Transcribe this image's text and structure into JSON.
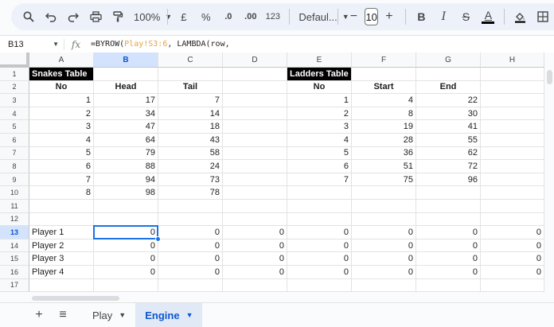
{
  "toolbar": {
    "zoom": "100%",
    "currency": "£",
    "percent": "%",
    "dec_decrease": ".0",
    "dec_increase": ".00",
    "number_format": "123",
    "font": "Defaul...",
    "font_size": "10",
    "minus": "−",
    "plus": "+",
    "bold": "B",
    "italic": "I",
    "strike": "S",
    "text_color": "A"
  },
  "formula_bar": {
    "name_box": "B13",
    "fx": "fx",
    "formula_prefix": "=BYROW(",
    "formula_ref": "Play!S3:6",
    "formula_suffix": ", LAMBDA(row,"
  },
  "columns": [
    "A",
    "B",
    "C",
    "D",
    "E",
    "F",
    "G",
    "H"
  ],
  "selected_column": "B",
  "rows": [
    "1",
    "2",
    "3",
    "4",
    "5",
    "6",
    "7",
    "8",
    "9",
    "10",
    "11",
    "12",
    "13",
    "14",
    "15",
    "16",
    "17"
  ],
  "selected_row": "13",
  "snakes": {
    "title": "Snakes Table",
    "headers": [
      "No",
      "Head",
      "Tail"
    ],
    "data": [
      [
        "1",
        "17",
        "7"
      ],
      [
        "2",
        "34",
        "14"
      ],
      [
        "3",
        "47",
        "18"
      ],
      [
        "4",
        "64",
        "43"
      ],
      [
        "5",
        "79",
        "58"
      ],
      [
        "6",
        "88",
        "24"
      ],
      [
        "7",
        "94",
        "73"
      ],
      [
        "8",
        "98",
        "78"
      ]
    ]
  },
  "ladders": {
    "title": "Ladders Table",
    "headers": [
      "No",
      "Start",
      "End"
    ],
    "data": [
      [
        "1",
        "4",
        "22"
      ],
      [
        "2",
        "8",
        "30"
      ],
      [
        "3",
        "19",
        "41"
      ],
      [
        "4",
        "28",
        "55"
      ],
      [
        "5",
        "36",
        "62"
      ],
      [
        "6",
        "51",
        "72"
      ],
      [
        "7",
        "75",
        "96"
      ]
    ]
  },
  "players": [
    {
      "name": "Player 1",
      "values": [
        "0",
        "0",
        "0",
        "0",
        "0",
        "0",
        "0"
      ]
    },
    {
      "name": "Player 2",
      "values": [
        "0",
        "0",
        "0",
        "0",
        "0",
        "0",
        "0"
      ]
    },
    {
      "name": "Player 3",
      "values": [
        "0",
        "0",
        "0",
        "0",
        "0",
        "0",
        "0"
      ]
    },
    {
      "name": "Player 4",
      "values": [
        "0",
        "0",
        "0",
        "0",
        "0",
        "0",
        "0"
      ]
    }
  ],
  "tabs": {
    "add": "+",
    "all_sheets": "≡",
    "sheets": [
      {
        "label": "Play",
        "active": false
      },
      {
        "label": "Engine",
        "active": true
      }
    ]
  }
}
